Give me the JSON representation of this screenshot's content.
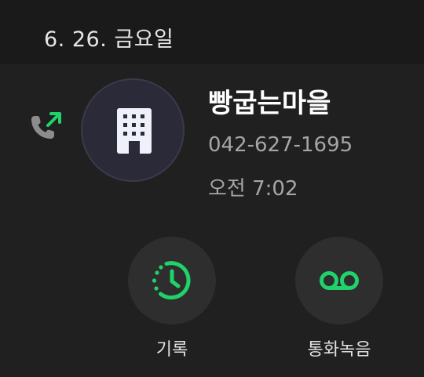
{
  "header": {
    "date": "6. 26. 금요일"
  },
  "call": {
    "direction_icon": "outgoing-call-icon",
    "avatar_icon": "building-icon",
    "name": "빵굽는마을",
    "number": "042-627-1695",
    "time": "오전 7:02"
  },
  "actions": {
    "history": {
      "icon": "history-icon",
      "label": "기록"
    },
    "recording": {
      "icon": "voicemail-icon",
      "label": "통화녹음"
    }
  },
  "colors": {
    "accent_green": "#1fd36a",
    "background": "#202020",
    "header_background": "#1a1a1a",
    "circle_background": "#2e2e2e"
  }
}
